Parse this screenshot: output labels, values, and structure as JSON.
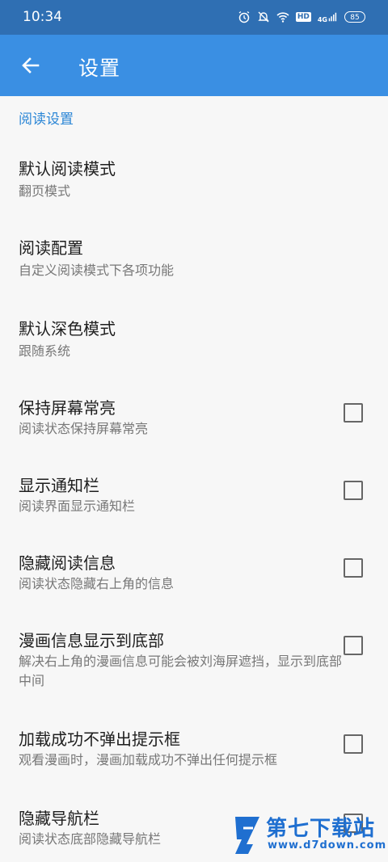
{
  "status_bar": {
    "time": "10:34",
    "battery": "85",
    "hd": "HD",
    "network": "4G"
  },
  "app_bar": {
    "title": "设置"
  },
  "section": {
    "header": "阅读设置"
  },
  "prefs": [
    {
      "title": "默认阅读模式",
      "summary": "翻页模式",
      "checkbox": false
    },
    {
      "title": "阅读配置",
      "summary": "自定义阅读模式下各项功能",
      "checkbox": false
    },
    {
      "title": "默认深色模式",
      "summary": "跟随系统",
      "checkbox": false
    },
    {
      "title": "保持屏幕常亮",
      "summary": "阅读状态保持屏幕常亮",
      "checkbox": true,
      "checked": false
    },
    {
      "title": "显示通知栏",
      "summary": "阅读界面显示通知栏",
      "checkbox": true,
      "checked": false
    },
    {
      "title": "隐藏阅读信息",
      "summary": "阅读状态隐藏右上角的信息",
      "checkbox": true,
      "checked": false
    },
    {
      "title": "漫画信息显示到底部",
      "summary": "解决右上角的漫画信息可能会被刘海屏遮挡，显示到底部中间",
      "checkbox": true,
      "checked": false
    },
    {
      "title": "加载成功不弹出提示框",
      "summary": "观看漫画时，漫画加载成功不弹出任何提示框",
      "checkbox": true,
      "checked": false
    },
    {
      "title": "隐藏导航栏",
      "summary": "阅读状态底部隐藏导航栏",
      "checkbox": true,
      "checked": false
    }
  ],
  "watermark": {
    "name": "第七下载站",
    "url": "www.d7down.com"
  },
  "colors": {
    "status_bar": "#2f6fb3",
    "app_bar": "#3a8fe3",
    "accent": "#2b86d6"
  }
}
